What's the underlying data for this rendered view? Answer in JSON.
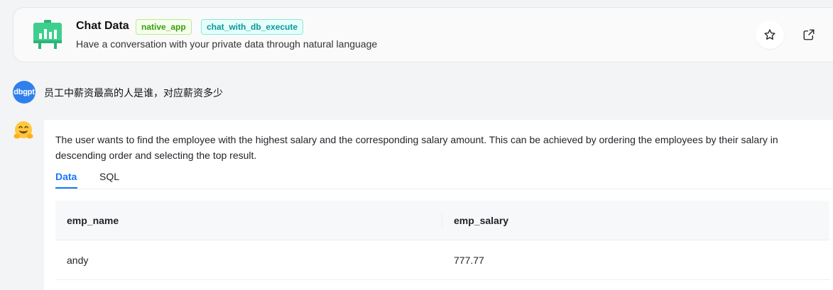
{
  "header": {
    "title": "Chat Data",
    "tags": [
      "native_app",
      "chat_with_db_execute"
    ],
    "description": "Have a conversation with your private data through natural language",
    "logo_icon": "chalkboard-chart-icon",
    "actions": [
      "star-icon",
      "share-icon"
    ]
  },
  "conversation": {
    "user": {
      "avatar_text": "dbgpt",
      "message": "员工中薪资最高的人是谁，对应薪资多少"
    },
    "bot": {
      "avatar_icon": "hugging-face-emoji-icon",
      "answer": "The user wants to find the employee with the highest salary and the corresponding salary amount. This can be achieved by ordering the employees by their salary in descending order and selecting the top result.",
      "tabs": [
        {
          "label": "Data",
          "active": true
        },
        {
          "label": "SQL",
          "active": false
        }
      ],
      "table": {
        "columns": [
          "emp_name",
          "emp_salary"
        ],
        "rows": [
          [
            "andy",
            "777.77"
          ]
        ]
      }
    }
  },
  "colors": {
    "accent": "#1677ff",
    "tag_green": "#389e0d",
    "tag_cyan": "#08979c",
    "logo_green": "#3ecf8e"
  }
}
